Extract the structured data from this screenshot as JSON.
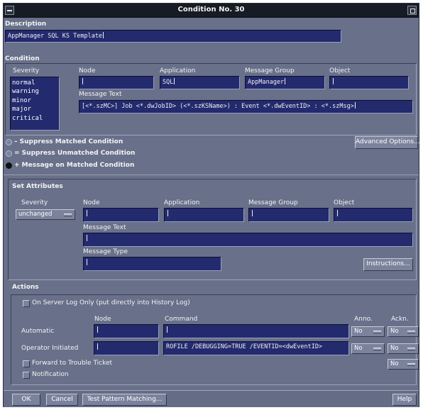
{
  "window": {
    "title": "Condition No. 30"
  },
  "description": {
    "label": "Description",
    "value": "AppManager SQL KS Template"
  },
  "condition": {
    "section_label": "Condition",
    "severity_label": "Severity",
    "severity_options": [
      "normal",
      "warning",
      "minor",
      "major",
      "critical"
    ],
    "node_label": "Node",
    "node_value": "",
    "application_label": "Application",
    "application_value": "SQL",
    "message_group_label": "Message Group",
    "message_group_value": "AppManager",
    "object_label": "Object",
    "object_value": "",
    "message_text_label": "Message Text",
    "message_text_value": "[<*.szMC>] Job <*.dwJobID> (<*.szKSName>) : Event <*.dwEventID> : <*.szMsg>"
  },
  "options": {
    "suppress_matched": "– Suppress Matched Condition",
    "suppress_unmatched": "= Suppress Unmatched Condition",
    "message_on_matched": "+ Message on Matched Condition",
    "advanced_button": "Advanced Options...",
    "selected": "message_on_matched"
  },
  "set_attributes": {
    "section_label": "Set Attributes",
    "severity_label": "Severity",
    "severity_value": "unchanged",
    "node_label": "Node",
    "node_value": "",
    "application_label": "Application",
    "application_value": "",
    "message_group_label": "Message Group",
    "message_group_value": "",
    "object_label": "Object",
    "object_value": "",
    "message_text_label": "Message Text",
    "message_text_value": "",
    "message_type_label": "Message Type",
    "message_type_value": "",
    "instructions_button": "Instructions..."
  },
  "actions": {
    "section_label": "Actions",
    "server_log_only": "On Server Log Only (put directly into History Log)",
    "node_col": "Node",
    "command_col": "Command",
    "anno_col": "Anno.",
    "ackn_col": "Ackn.",
    "automatic_label": "Automatic",
    "automatic_node": "",
    "automatic_command": "",
    "automatic_anno": "No",
    "automatic_ackn": "No",
    "operator_label": "Operator Initiated",
    "operator_node": "",
    "operator_command": "ROFILE /DEBUGGING=TRUE /EVENTID=<dwEventID>",
    "operator_anno": "No",
    "operator_ackn": "No",
    "forward_label": "Forward to Trouble Ticket",
    "forward_value": "No",
    "notification_label": "Notification"
  },
  "buttons": {
    "ok": "OK",
    "cancel": "Cancel",
    "test": "Test Pattern Matching...",
    "help": "Help"
  }
}
